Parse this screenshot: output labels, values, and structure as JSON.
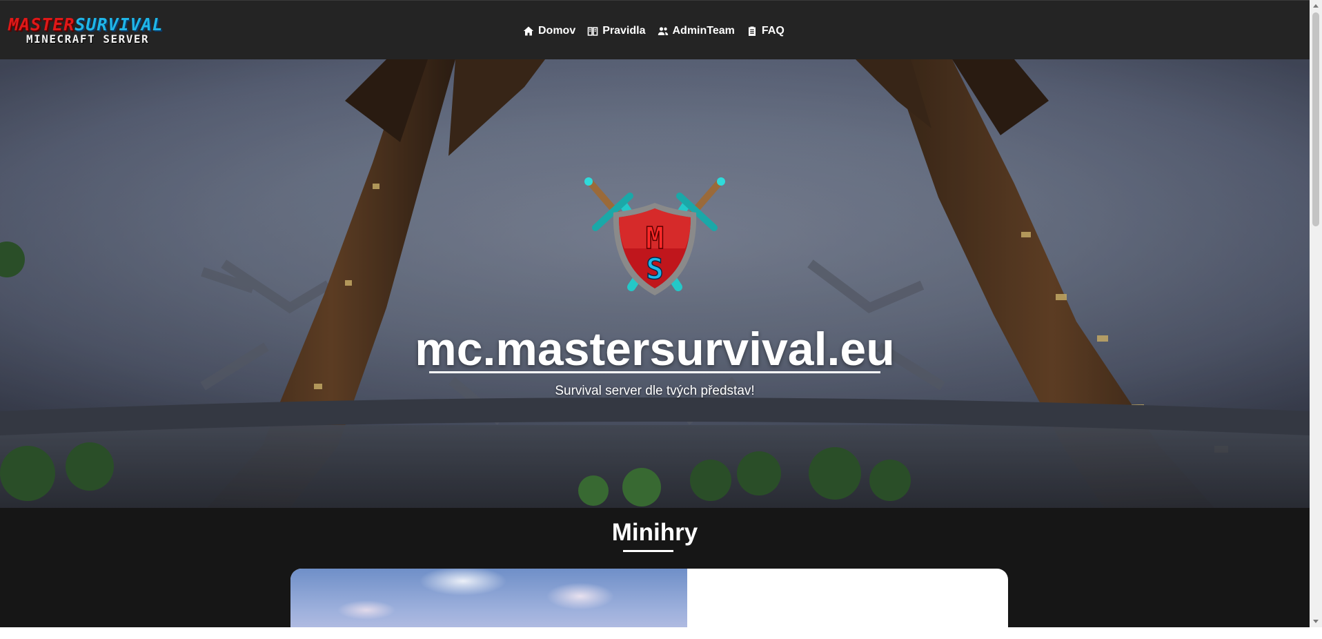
{
  "header": {
    "brand": {
      "word1": "MASTER",
      "word2": "SURVIVAL",
      "line2": "MINECRAFT SERVER"
    },
    "nav": [
      {
        "label": "Domov",
        "icon": "home-icon"
      },
      {
        "label": "Pravidla",
        "icon": "book-icon"
      },
      {
        "label": "AdminTeam",
        "icon": "users-icon"
      },
      {
        "label": "FAQ",
        "icon": "clipboard-icon"
      }
    ]
  },
  "hero": {
    "title": "mc.mastersurvival.eu",
    "subtitle": "Survival server dle tvých představ!",
    "logo_letters": [
      "M",
      "S"
    ]
  },
  "section": {
    "title": "Minihry"
  },
  "colors": {
    "nav_bg": "#242424",
    "page_bg": "#161616",
    "brand_red": "#e01818",
    "brand_blue": "#1fb6e8",
    "shield_red": "#c0161c",
    "sword_cyan": "#24c8c8"
  }
}
